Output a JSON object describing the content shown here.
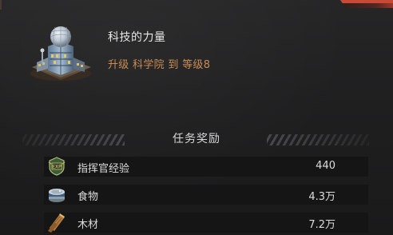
{
  "quest": {
    "title": "科技的力量",
    "description": "升级 科学院 到 等级8",
    "building_icon": "academy-building-icon"
  },
  "rewards": {
    "title": "任务奖励",
    "items": [
      {
        "icon": "commander-exp-icon",
        "label": "指挥官经验",
        "value": "440"
      },
      {
        "icon": "food-can-icon",
        "label": "食物",
        "value": "4.3万"
      },
      {
        "icon": "wood-icon",
        "label": "木材",
        "value": "7.2万"
      }
    ]
  },
  "colors": {
    "title_text": "#e6e6e6",
    "description_text": "#c98c55",
    "row_background": "#151516",
    "panel_background": "#1f1f20",
    "accent_red": "#c64a36"
  }
}
